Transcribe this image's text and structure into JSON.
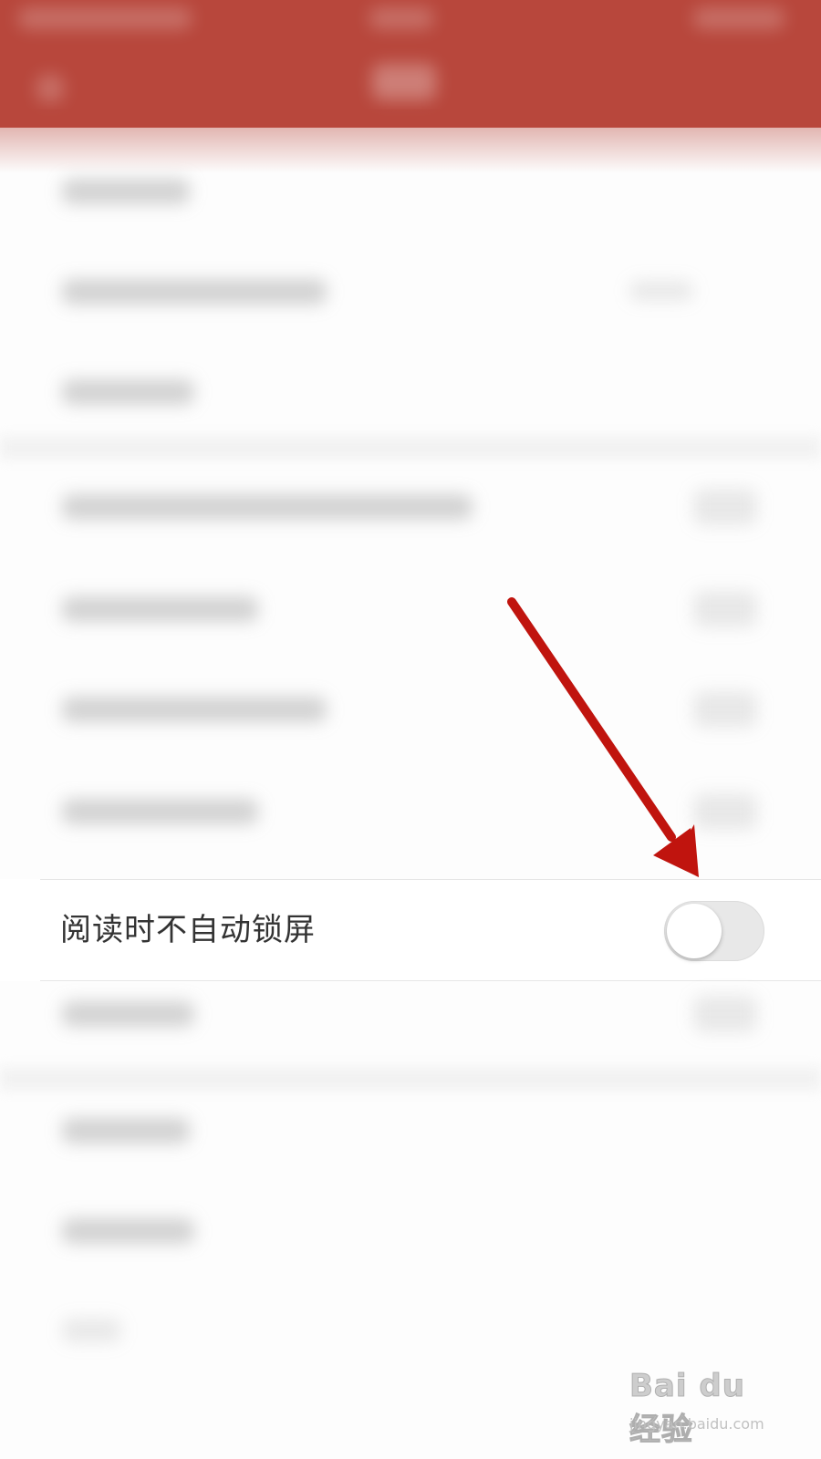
{
  "settings": {
    "lock_screen_row": {
      "label": "阅读时不自动锁屏",
      "toggle_on": false
    }
  },
  "watermark": {
    "logo": "Bai du 经验",
    "url": "jingyan.baidu.com"
  },
  "colors": {
    "header": "#b8473c",
    "annotation_arrow": "#c0140e",
    "toggle_track_off": "#e8e8e8"
  }
}
